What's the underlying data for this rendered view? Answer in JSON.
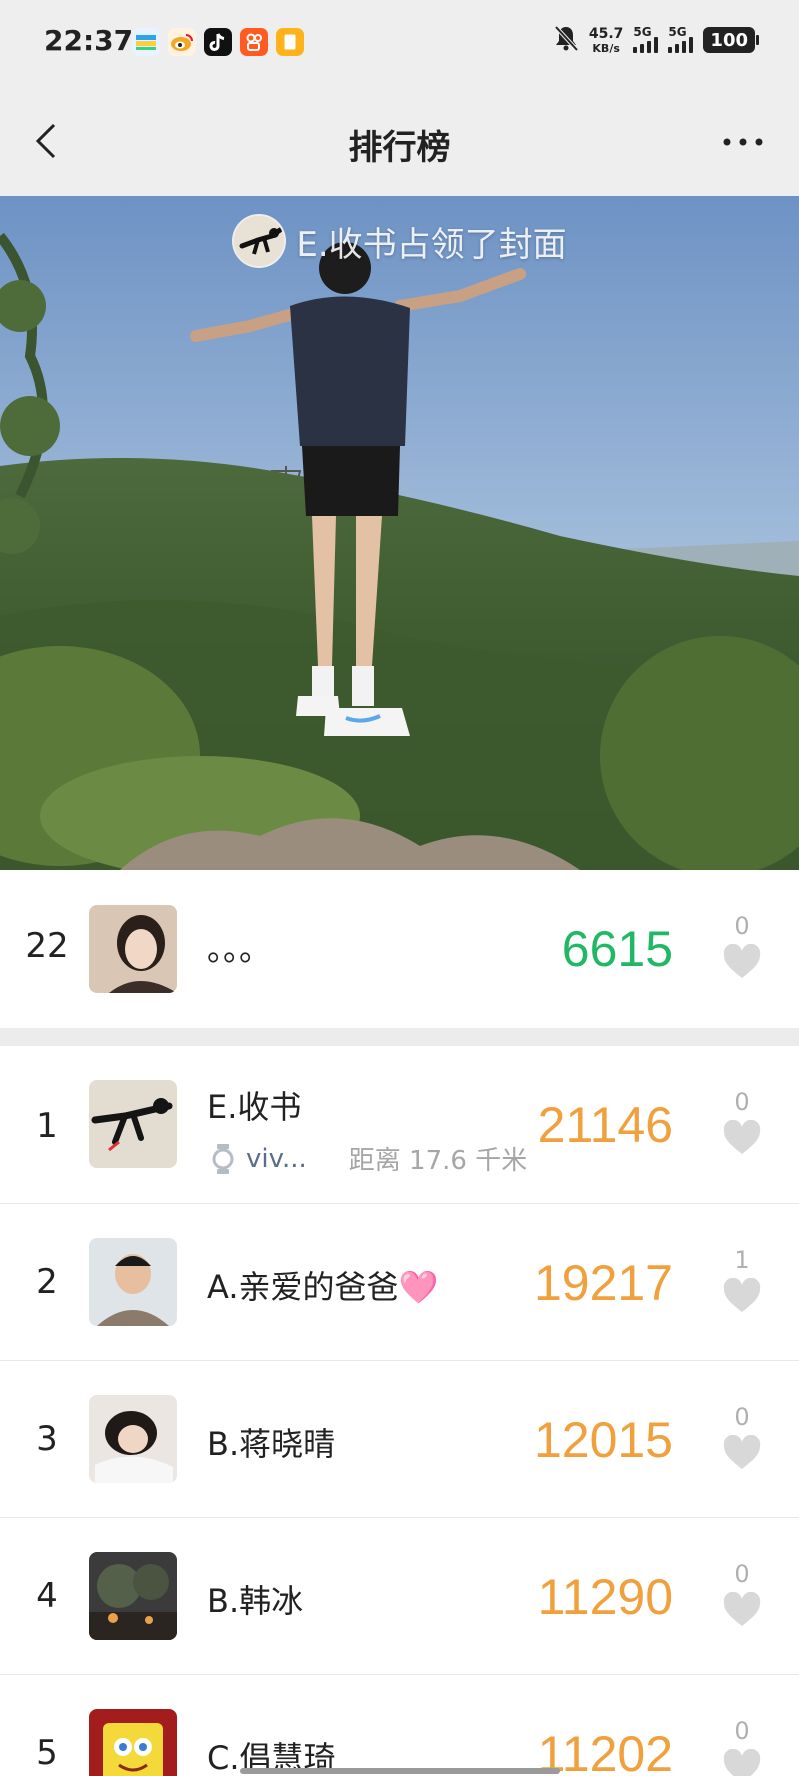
{
  "status_bar": {
    "time": "22:37",
    "net_speed_value": "45.7",
    "net_speed_unit": "KB/s",
    "signal1_label": "5G",
    "signal2_label": "5G",
    "battery": "100"
  },
  "nav": {
    "title": "排行榜"
  },
  "cover": {
    "caption": "E.收书占领了封面"
  },
  "my_rank": {
    "rank": "22",
    "name": "。。。",
    "steps": "6615",
    "likes": "0"
  },
  "ranking": [
    {
      "rank": "1",
      "name": "E.收书",
      "device": "viv...",
      "distance": "距离 17.6 千米",
      "steps": "21146",
      "likes": "0"
    },
    {
      "rank": "2",
      "name": "A.亲爱的爸爸🩷",
      "steps": "19217",
      "likes": "1"
    },
    {
      "rank": "3",
      "name": "B.蒋晓晴",
      "steps": "12015",
      "likes": "0"
    },
    {
      "rank": "4",
      "name": "B.韩冰",
      "steps": "11290",
      "likes": "0"
    },
    {
      "rank": "5",
      "name": "C.倡慧琦",
      "steps": "11202",
      "likes": "0"
    }
  ],
  "colors": {
    "my_score": "#20b865",
    "score": "#f0a03c",
    "like_gray": "#d8d8d8"
  }
}
